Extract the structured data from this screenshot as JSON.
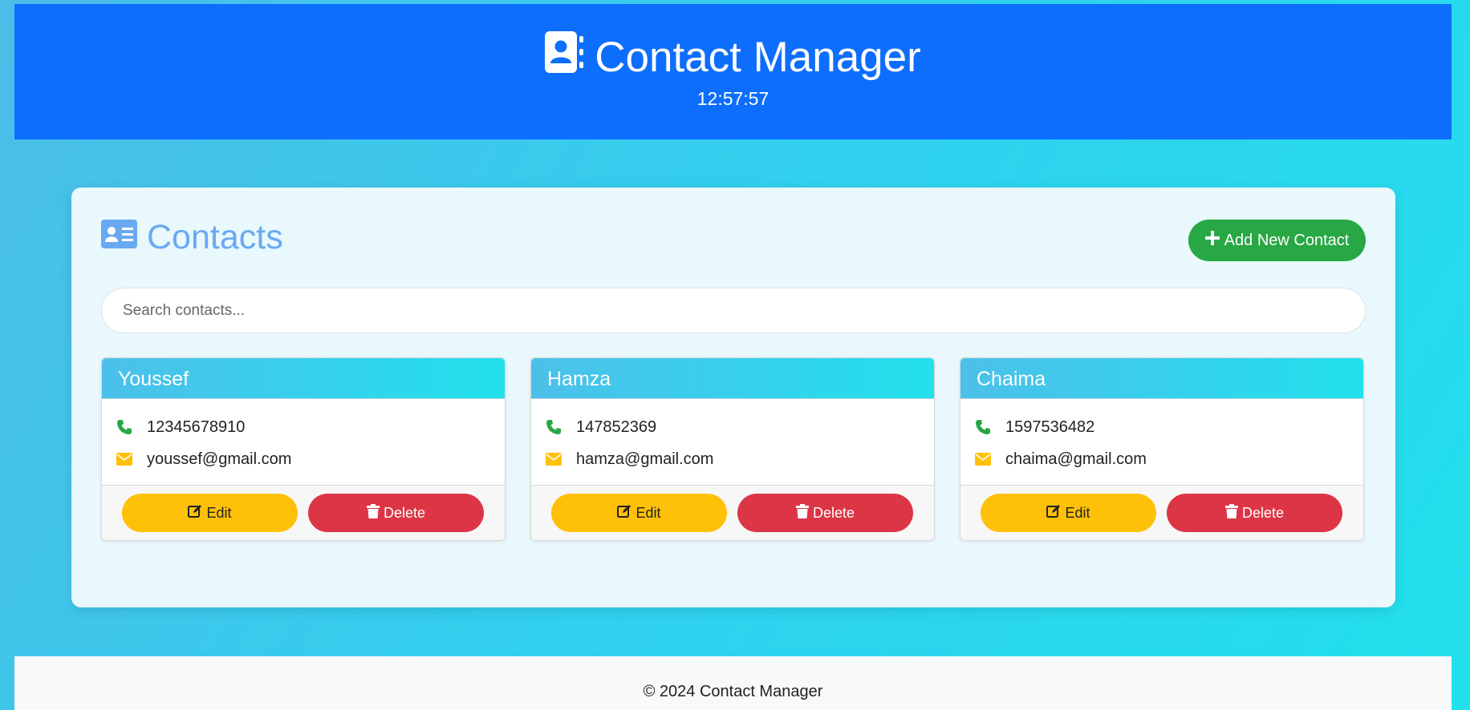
{
  "header": {
    "title": "Contact Manager",
    "time": "12:57:57",
    "icon": "address-book-icon"
  },
  "panel": {
    "title": "Contacts",
    "title_icon": "id-card-icon",
    "add_button": "Add New Contact",
    "search": {
      "placeholder": "Search contacts...",
      "value": ""
    }
  },
  "contacts": [
    {
      "name": "Youssef",
      "phone": "12345678910",
      "email": "youssef@gmail.com",
      "edit": "Edit",
      "delete": "Delete"
    },
    {
      "name": "Hamza",
      "phone": "147852369",
      "email": "hamza@gmail.com",
      "edit": "Edit",
      "delete": "Delete"
    },
    {
      "name": "Chaima",
      "phone": "1597536482",
      "email": "chaima@gmail.com",
      "edit": "Edit",
      "delete": "Delete"
    }
  ],
  "footer": {
    "text": "© 2024 Contact Manager"
  },
  "colors": {
    "header": "#0d6efd",
    "add": "#28a745",
    "edit": "#ffc107",
    "delete": "#dc3545",
    "phone_icon": "#28a745",
    "mail_icon": "#ffc107",
    "panel_title": "#6aa9f2"
  }
}
